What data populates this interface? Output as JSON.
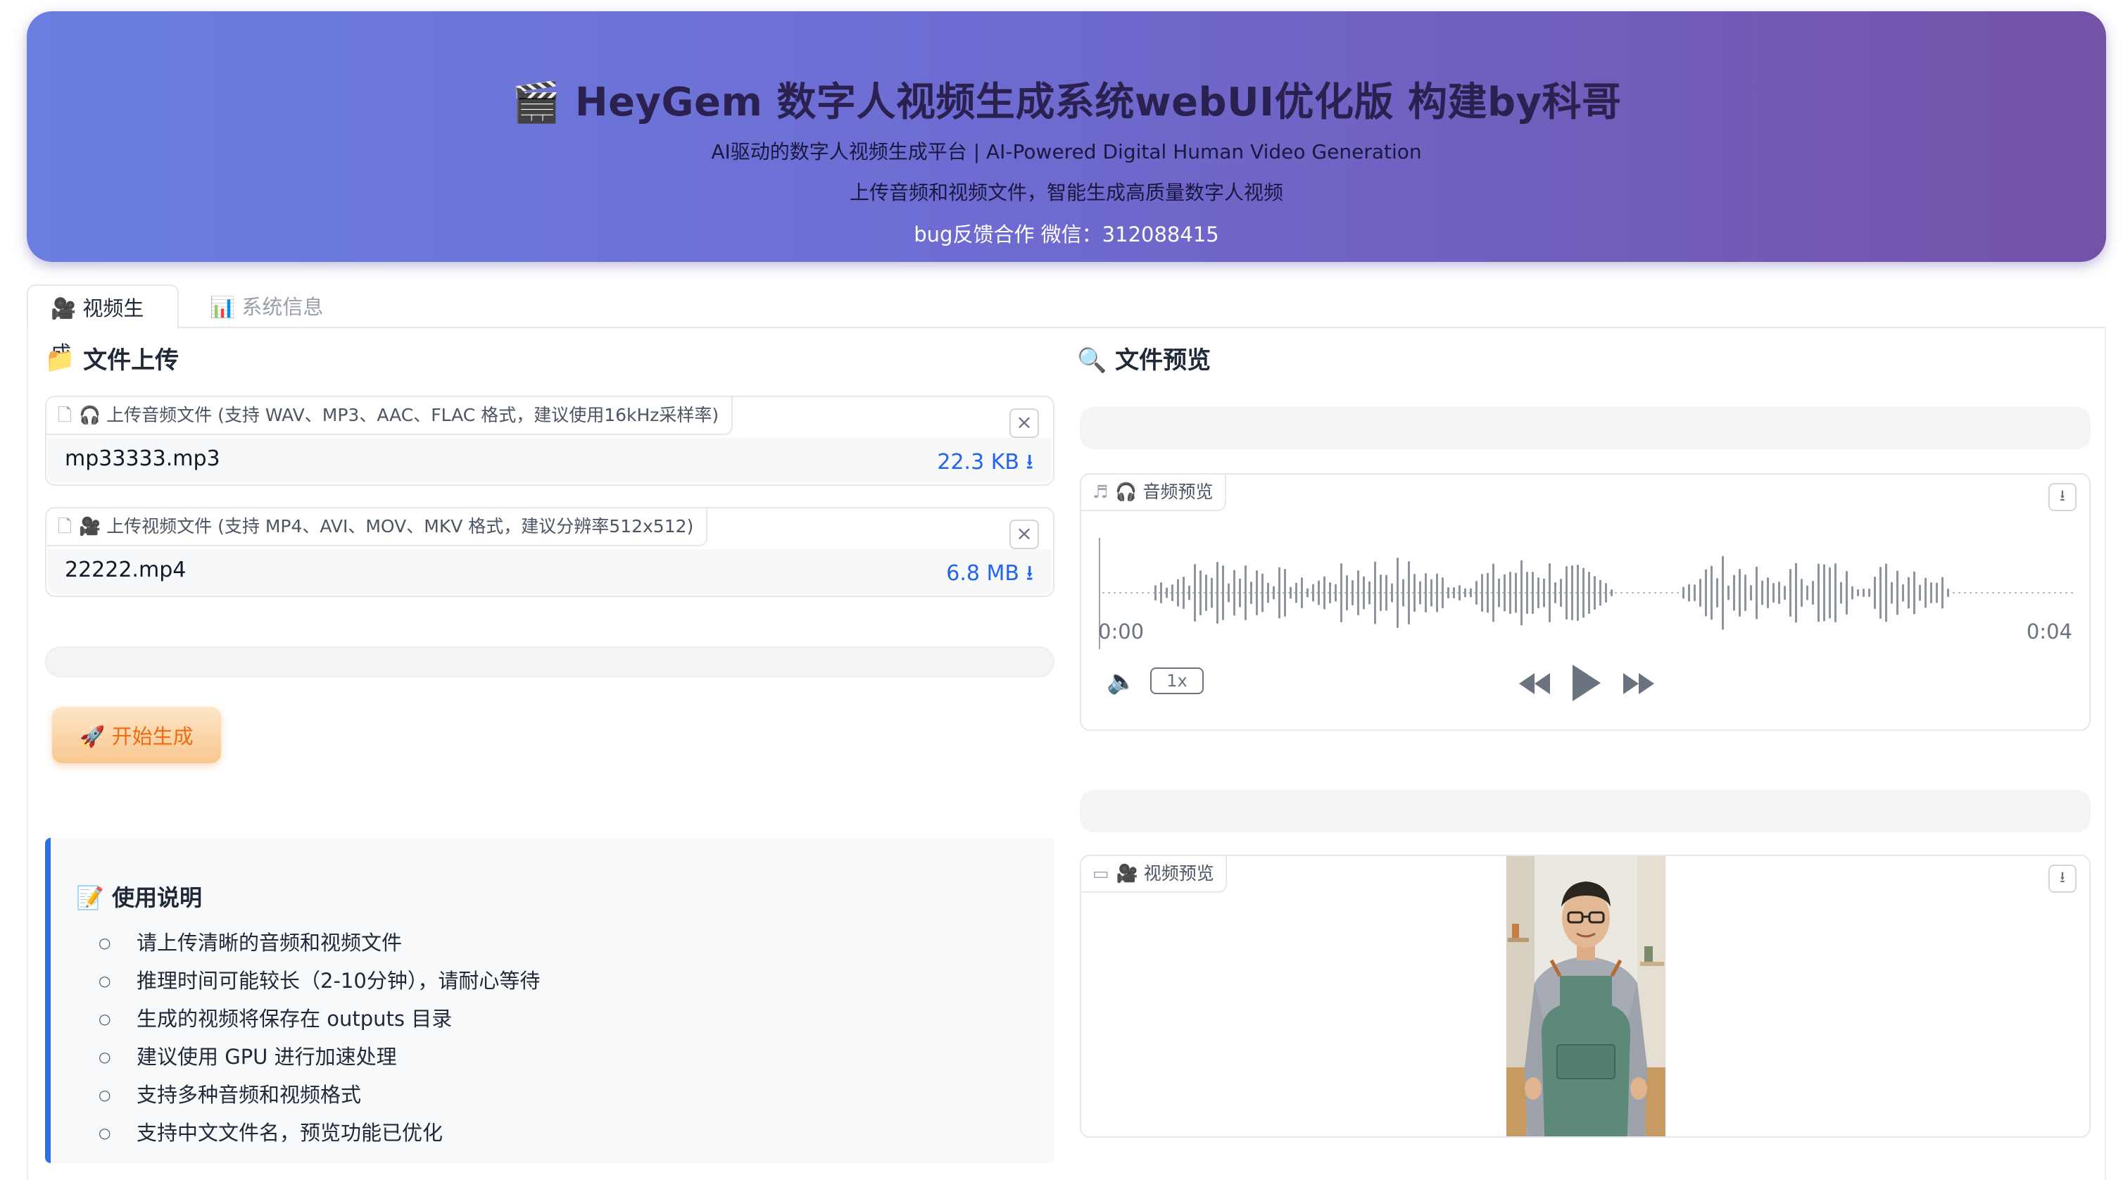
{
  "header": {
    "title": "🎬 HeyGem 数字人视频生成系统webUI优化版 构建by科哥",
    "line1": "AI驱动的数字人视频生成平台 | AI-Powered Digital Human Video Generation",
    "line2": "上传音频和视频文件，智能生成高质量数字人视频",
    "line3": "bug反馈合作 微信：312088415"
  },
  "tabs": [
    {
      "label": "🎥 视频生成"
    },
    {
      "label": "📊 系统信息"
    }
  ],
  "upload": {
    "title": "📁 文件上传",
    "audio": {
      "label": "🎧 上传音频文件 (支持 WAV、MP3、AAC、FLAC 格式，建议使用16kHz采样率)",
      "file_name": "mp33333.mp3",
      "file_size": "22.3 KB ⭳"
    },
    "video": {
      "label": "🎥 上传视频文件 (支持 MP4、AVI、MOV、MKV 格式，建议分辨率512x512)",
      "file_name": "22222.mp4",
      "file_size": "6.8 MB ⭳"
    },
    "start_button": "🚀 开始生成"
  },
  "usage": {
    "title": "📝 使用说明",
    "items": [
      "请上传清晰的音频和视频文件",
      "推理时间可能较长（2-10分钟），请耐心等待",
      "生成的视频将保存在 outputs 目录",
      "建议使用 GPU 进行加速处理",
      "支持多种音频和视频格式",
      "支持中文文件名，预览功能已优化"
    ]
  },
  "preview": {
    "title": "🔍 文件预览",
    "audio_label": "🎧 音频预览",
    "time_start": "0:00",
    "time_end": "0:04",
    "speed": "1x",
    "video_label": "🎥 视频预览"
  },
  "colors": {
    "accent_blue": "#2563eb",
    "start_button_text": "#f06b12",
    "usage_border": "#2f6fe0"
  }
}
